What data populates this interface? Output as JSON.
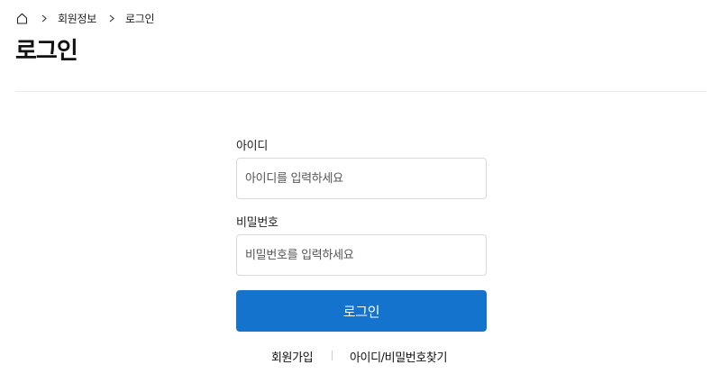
{
  "breadcrumb": {
    "home_icon": "home-icon",
    "separator_icon": "chevron-right-icon",
    "items": [
      "회원정보",
      "로그인"
    ]
  },
  "page": {
    "title": "로그인"
  },
  "form": {
    "id_label": "아이디",
    "id_placeholder": "아이디를 입력하세요",
    "id_value": "",
    "password_label": "비밀번호",
    "password_placeholder": "비밀번호를 입력하세요",
    "password_value": "",
    "submit_label": "로그인"
  },
  "links": {
    "signup": "회원가입",
    "find_account": "아이디/비밀번호찾기"
  },
  "colors": {
    "primary_button": "#1473cc",
    "input_border": "#d9d9d9",
    "divider": "#ebebeb"
  }
}
